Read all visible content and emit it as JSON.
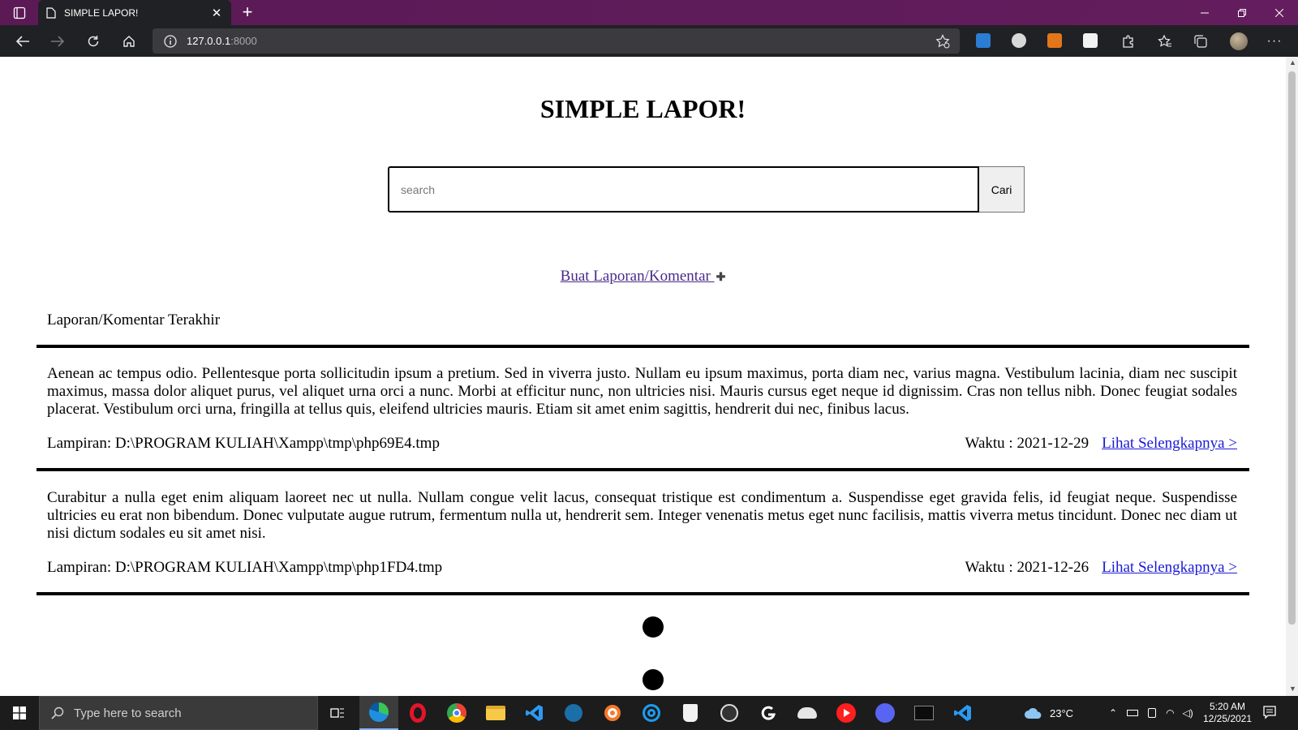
{
  "browser": {
    "tab_title": "SIMPLE LAPOR!",
    "tab_close": "✕",
    "new_tab": "+",
    "url_host": "127.0.0.1",
    "url_port": ":8000",
    "menu_dots": "···"
  },
  "page": {
    "title": "SIMPLE LAPOR!",
    "search": {
      "placeholder": "search",
      "value": "",
      "button": "Cari"
    },
    "create_link": "Buat Laporan/Komentar ",
    "create_plus": "✚",
    "section_title": "Laporan/Komentar Terakhir",
    "reports": [
      {
        "body": "Aenean ac tempus odio. Pellentesque porta sollicitudin ipsum a pretium. Sed in viverra justo. Nullam eu ipsum maximus, porta diam nec, varius magna. Vestibulum lacinia, diam nec suscipit maximus, massa dolor aliquet purus, vel aliquet urna orci a nunc. Morbi at efficitur nunc, non ultricies nisi. Mauris cursus eget neque id dignissim. Cras non tellus nibh. Donec feugiat sodales placerat. Vestibulum orci urna, fringilla at tellus quis, eleifend ultricies mauris. Etiam sit amet enim sagittis, hendrerit dui nec, finibus lacus.",
        "attachment": "Lampiran: D:\\PROGRAM KULIAH\\Xampp\\tmp\\php69E4.tmp",
        "time": "Waktu : 2021-12-29",
        "link": "Lihat Selengkapnya >"
      },
      {
        "body": "Curabitur a nulla eget enim aliquam laoreet nec ut nulla. Nullam congue velit lacus, consequat tristique est condimentum a. Suspendisse eget gravida felis, id feugiat neque. Suspendisse ultricies eu erat non bibendum. Donec vulputate augue rutrum, fermentum nulla ut, hendrerit sem. Integer venenatis metus eget nunc facilisis, mattis viverra metus tincidunt. Donec nec diam ut nisi dictum sodales eu sit amet nisi.",
        "attachment": "Lampiran: D:\\PROGRAM KULIAH\\Xampp\\tmp\\php1FD4.tmp",
        "time": "Waktu : 2021-12-26",
        "link": "Lihat Selengkapnya >"
      }
    ]
  },
  "taskbar": {
    "search_placeholder": "Type here to search",
    "weather": "23°C",
    "time": "5:20 AM",
    "date": "12/25/2021"
  },
  "colors": {
    "titlebar": "#5e1c5a",
    "toolbar": "#202124",
    "link_visited": "#4a2a8a",
    "link": "#1a1ad6",
    "taskbar": "#1c1c1c"
  }
}
